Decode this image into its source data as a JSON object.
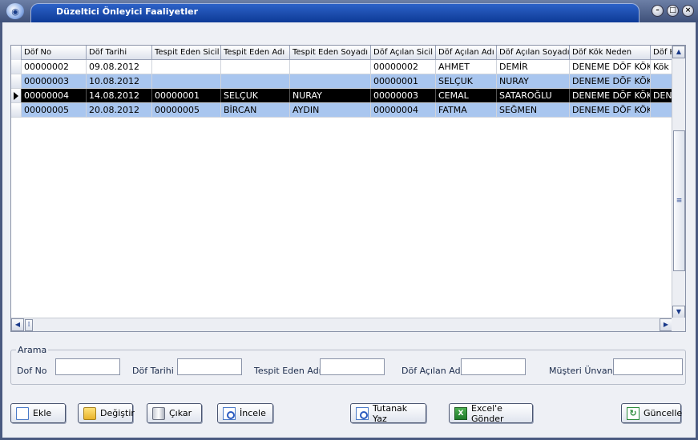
{
  "window": {
    "title": "Düzeltici Önleyici Faaliyetler"
  },
  "grid": {
    "columns": [
      "Döf No",
      "Döf Tarihi",
      "Tespit Eden Sicil",
      "Tespit Eden Adı",
      "Tespit Eden Soyadı",
      "Döf Açılan Sicil",
      "Döf Açılan Adı",
      "Döf Açılan Soyadı",
      "Döf Kök Neden",
      "Döf K"
    ],
    "rows": [
      [
        "00000002",
        "09.08.2012",
        "",
        "",
        "",
        "00000002",
        "AHMET",
        "DEMİR",
        "DENEME DÖF KÖK",
        "Kök n"
      ],
      [
        "00000003",
        "10.08.2012",
        "",
        "",
        "",
        "00000001",
        "SELÇUK",
        "NURAY",
        "DENEME DÖF KÖK",
        ""
      ],
      [
        "00000004",
        "14.08.2012",
        "00000001",
        "SELÇUK",
        "NURAY",
        "00000003",
        "CEMAL",
        "SATAROĞLU",
        "DENEME DÖF KÖK",
        "DENE"
      ],
      [
        "00000005",
        "20.08.2012",
        "00000005",
        "BİRCAN",
        "AYDIN",
        "00000004",
        "FATMA",
        "SEĞMEN",
        "DENEME DÖF KÖK",
        ""
      ]
    ],
    "selected_row": 3
  },
  "search": {
    "title": "Arama",
    "labels": {
      "dof_no": "Dof No",
      "dof_tarihi": "Döf Tarihi",
      "tespit_eden_adi": "Tespit Eden Adı",
      "dof_acilan_adi": "Döf Açılan Adı",
      "musteri_unvani": "Müşteri Ünvanı"
    },
    "values": {
      "dof_no": "",
      "dof_tarihi": "",
      "tespit_eden_adi": "",
      "dof_acilan_adi": "",
      "musteri_unvani": ""
    }
  },
  "buttons": {
    "ekle": "Ekle",
    "degistir": "Değiştir",
    "cikar": "Çıkar",
    "incele": "İncele",
    "tutanak": "Tutanak Yaz",
    "excel": "Excel'e Gönder",
    "guncelle": "Güncelle"
  },
  "icons": {
    "app": "app-globe-icon",
    "minimize": "minimize-icon",
    "maximize": "maximize-icon",
    "close": "close-icon"
  },
  "colors": {
    "title_bar": "#0d3a96",
    "row_alt": "#a9c6ef",
    "row_selected": "#000000"
  }
}
